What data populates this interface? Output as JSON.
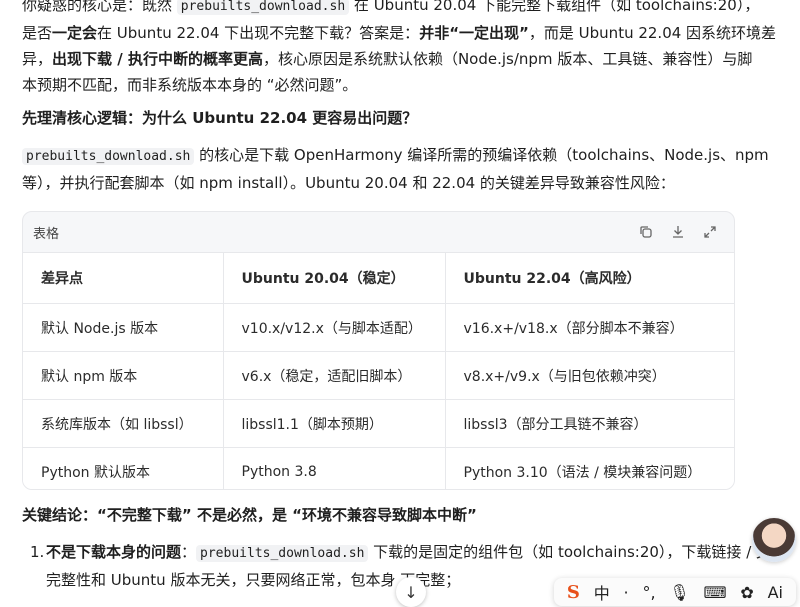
{
  "paragraph1": {
    "line1_a": "你疑惑的核心是：既然 ",
    "line1_code": "prebuilts_download.sh",
    "line1_b": " 在 Ubuntu 20.04 下能完整下载组件（如 toolchains:20），",
    "line2_a": "是否",
    "line2_bold1": "一定会",
    "line2_b": "在 Ubuntu 22.04 下出现不完整下载？答案是：",
    "line2_bold2": "并非“一定出现”",
    "line2_c": "，而是 Ubuntu 22.04 因系统环境差",
    "line3_a": "异，",
    "line3_bold": "出现下载 / 执行中断的概率更高",
    "line3_b": "，核心原因是系统默认依赖（Node.js/npm 版本、工具链、兼容性）与脚",
    "line4": "本预期不匹配，而非系统版本本身的 “必然问题”。"
  },
  "heading": "先理清核心逻辑：为什么 Ubuntu 22.04 更容易出问题？",
  "paragraph2": {
    "code": "prebuilts_download.sh",
    "line1": " 的核心是下载 OpenHarmony 编译所需的预编译依赖（toolchains、Node.js、npm",
    "line2": "等），并执行配套脚本（如 npm install）。Ubuntu 20.04 和 22.04 的关键差异导致兼容性风险："
  },
  "table": {
    "title": "表格",
    "icons": [
      "copy-icon",
      "download-icon",
      "expand-icon"
    ],
    "headers": [
      "差异点",
      "Ubuntu 20.04（稳定）",
      "Ubuntu 22.04（高风险）"
    ],
    "rows": [
      [
        "默认 Node.js 版本",
        "v10.x/v12.x（与脚本适配）",
        "v16.x+/v18.x（部分脚本不兼容）"
      ],
      [
        "默认 npm 版本",
        "v6.x（稳定，适配旧脚本）",
        "v8.x+/v9.x（与旧包依赖冲突）"
      ],
      [
        "系统库版本（如 libssl）",
        "libssl1.1（脚本预期）",
        "libssl3（部分工具链不兼容）"
      ],
      [
        "Python 默认版本",
        "Python 3.8",
        "Python 3.10（语法 / 模块兼容问题）"
      ]
    ]
  },
  "conclusion": "关键结论：“不完整下载” 不是必然，是 “环境不兼容导致脚本中断”",
  "list": {
    "number": "1.",
    "bold": "不是下载本身的问题",
    "colon": "：",
    "code": "prebuilts_download.sh",
    "text1": " 下载的是固定的组件包（如 toolchains:20），下载链接 / 文",
    "text2": "完整性和 Ubuntu 版本无关，只要网络正常，包本身 ",
    "text2_end": "下完整；"
  },
  "floating": {
    "scroll_down": "↓",
    "ime_logo": "S",
    "ime_items": [
      "中",
      "·",
      "°,",
      "🎙",
      "⌨",
      "✿",
      "Ai"
    ]
  }
}
